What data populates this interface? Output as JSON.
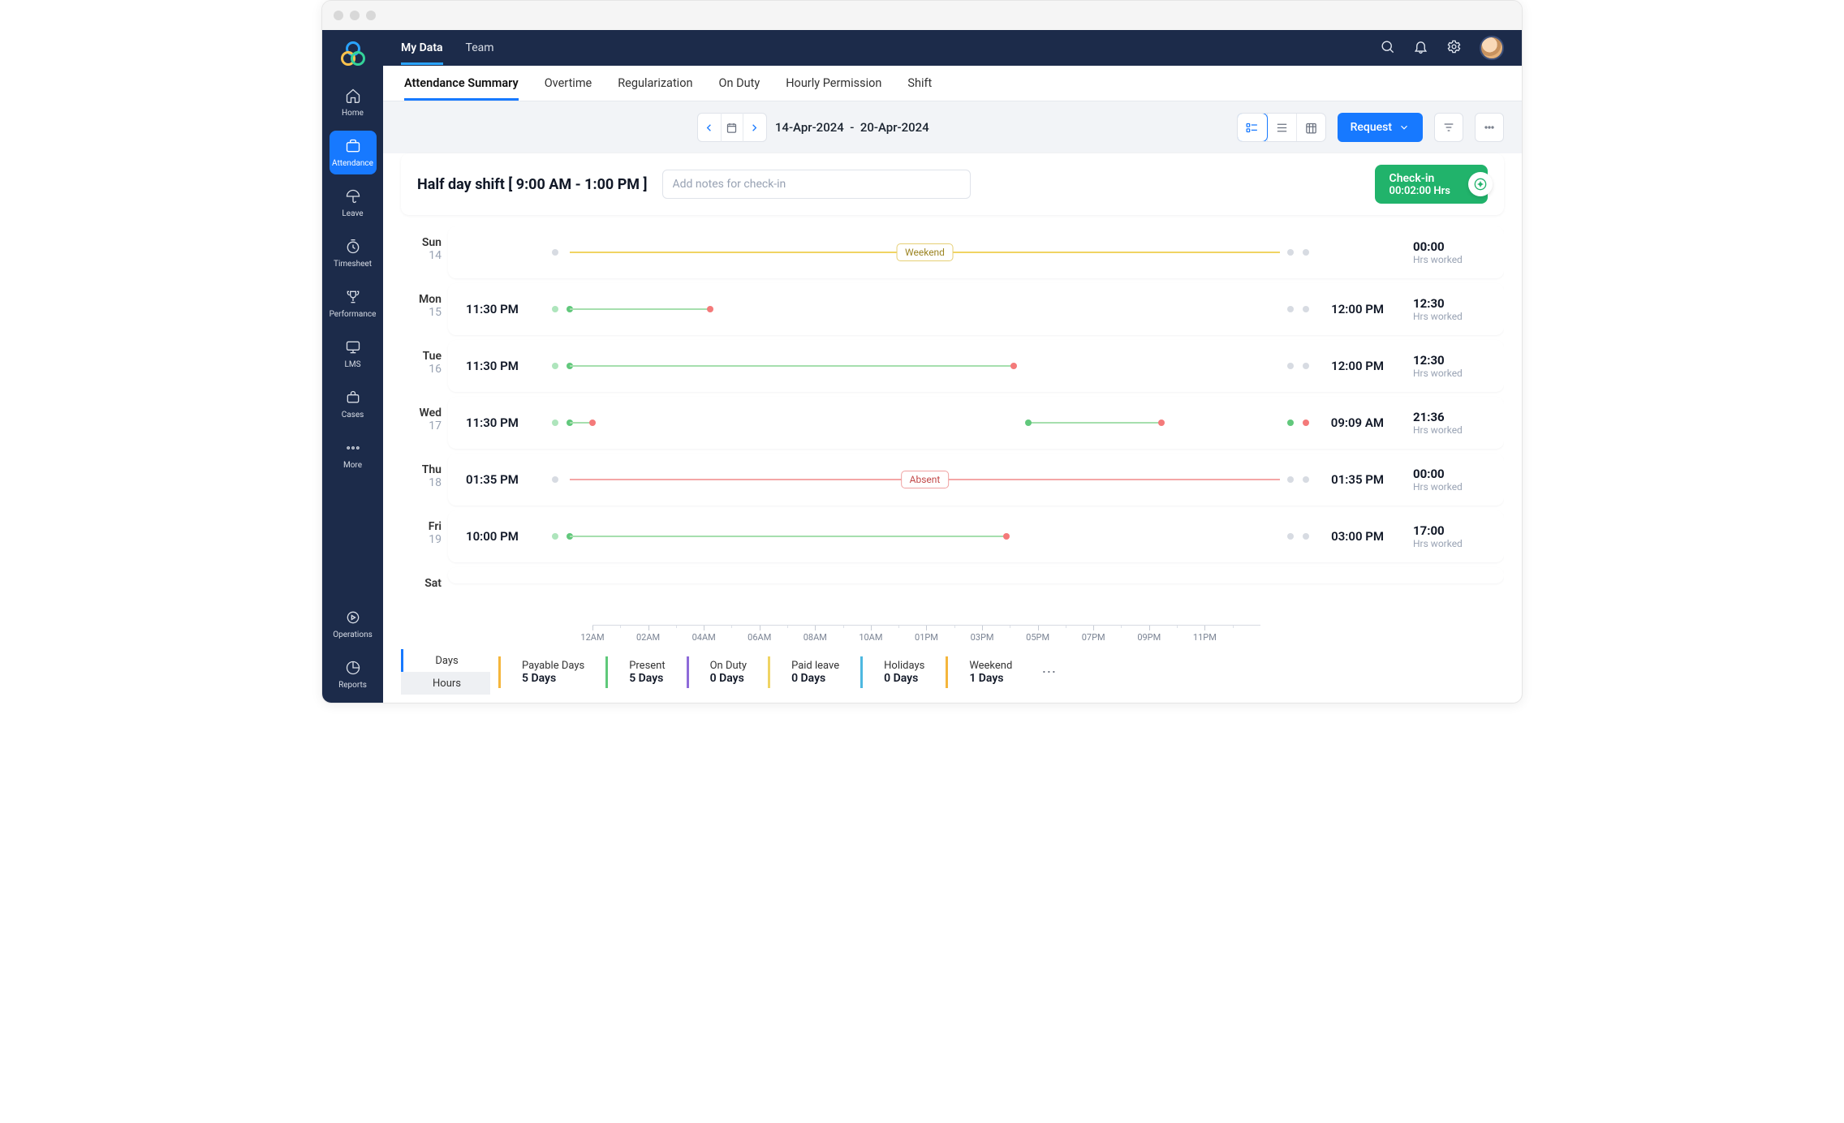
{
  "sidebar": {
    "items": [
      {
        "label": "Home"
      },
      {
        "label": "Attendance"
      },
      {
        "label": "Leave"
      },
      {
        "label": "Timesheet"
      },
      {
        "label": "Performance"
      },
      {
        "label": "LMS"
      },
      {
        "label": "Cases"
      },
      {
        "label": "More"
      },
      {
        "label": "Operations"
      },
      {
        "label": "Reports"
      }
    ]
  },
  "topnav": {
    "tabs": [
      {
        "label": "My Data",
        "active": true
      },
      {
        "label": "Team"
      }
    ]
  },
  "subtabs": {
    "tabs": [
      {
        "label": "Attendance Summary",
        "active": true
      },
      {
        "label": "Overtime"
      },
      {
        "label": "Regularization"
      },
      {
        "label": "On Duty"
      },
      {
        "label": "Hourly Permission"
      },
      {
        "label": "Shift"
      }
    ]
  },
  "toolbar": {
    "date_from": "14-Apr-2024",
    "date_to": "20-Apr-2024",
    "request_label": "Request"
  },
  "checkin": {
    "shift_label": "Half day shift [ 9:00 AM - 1:00 PM ]",
    "notes_placeholder": "Add notes for check-in",
    "btn_title": "Check-in",
    "btn_timer": "00:02:00 Hrs"
  },
  "axis_labels": [
    "12AM",
    "02AM",
    "04AM",
    "06AM",
    "08AM",
    "10AM",
    "01PM",
    "03PM",
    "05PM",
    "07PM",
    "09PM",
    "11PM"
  ],
  "hrs_label": "Hrs worked",
  "days": [
    {
      "dow": "Sun",
      "dnum": "14",
      "in": "",
      "out": "",
      "hrs": "00:00",
      "type": "weekend",
      "tag": "Weekend"
    },
    {
      "dow": "Mon",
      "dnum": "15",
      "in": "11:30 PM",
      "out": "12:00 PM",
      "hrs": "12:30",
      "type": "present",
      "bar_end": 21
    },
    {
      "dow": "Tue",
      "dnum": "16",
      "in": "11:30 PM",
      "out": "12:00 PM",
      "hrs": "12:30",
      "type": "present",
      "bar_end": 62
    },
    {
      "dow": "Wed",
      "dnum": "17",
      "in": "11:30 PM",
      "out": "09:09 AM",
      "hrs": "21:36",
      "type": "split"
    },
    {
      "dow": "Thu",
      "dnum": "18",
      "in": "01:35 PM",
      "out": "01:35 PM",
      "hrs": "00:00",
      "type": "absent",
      "tag": "Absent"
    },
    {
      "dow": "Fri",
      "dnum": "19",
      "in": "10:00 PM",
      "out": "03:00 PM",
      "hrs": "17:00",
      "type": "present",
      "bar_end": 61
    },
    {
      "dow": "Sat",
      "dnum": "",
      "in": "",
      "out": "",
      "hrs": "",
      "type": ""
    }
  ],
  "summary": {
    "toggle": {
      "days": "Days",
      "hours": "Hours"
    },
    "stats": [
      {
        "label": "Payable Days",
        "value": "5 Days",
        "color": "#f5b63c"
      },
      {
        "label": "Present",
        "value": "5 Days",
        "color": "#5fc97a"
      },
      {
        "label": "On Duty",
        "value": "0 Days",
        "color": "#8e6bd9"
      },
      {
        "label": "Paid leave",
        "value": "0 Days",
        "color": "#f0d463"
      },
      {
        "label": "Holidays",
        "value": "0 Days",
        "color": "#4db8e0"
      },
      {
        "label": "Weekend",
        "value": "1 Days",
        "color": "#f5b63c"
      }
    ]
  }
}
